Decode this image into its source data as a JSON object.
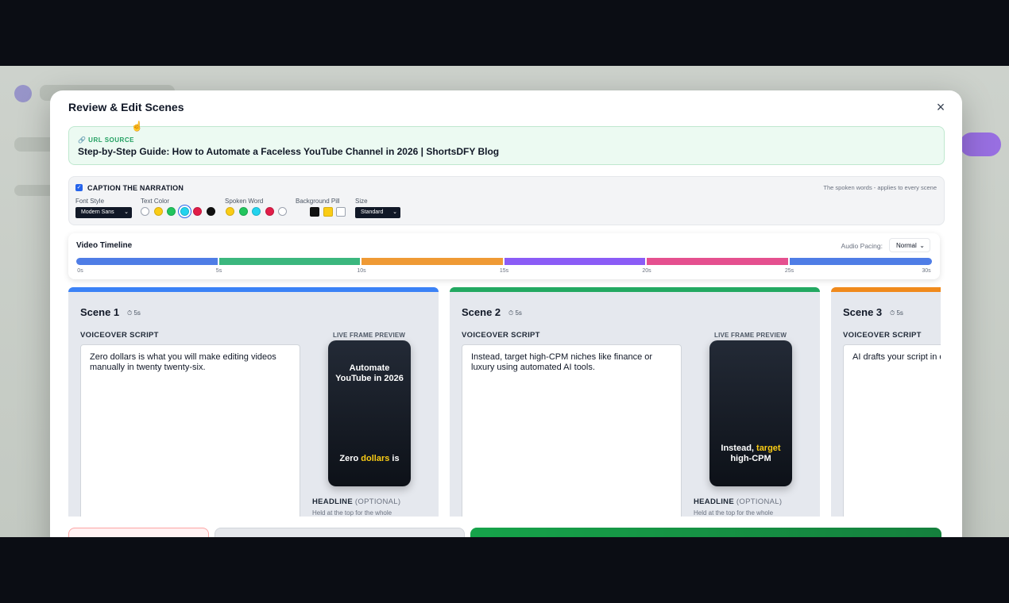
{
  "modal": {
    "title": "Review & Edit Scenes",
    "close_icon": "×"
  },
  "source": {
    "label": "🔗 URL SOURCE",
    "title": "Step-by-Step Guide: How to Automate a Faceless YouTube Channel in 2026 | ShortsDFY Blog"
  },
  "caption": {
    "checked": true,
    "title": "CAPTION THE NARRATION",
    "note": "The spoken words - applies to every scene",
    "font_style": {
      "label": "Font Style",
      "value": "Modern Sans"
    },
    "text_color": {
      "label": "Text Color",
      "swatches": [
        "#ffffff",
        "#facc15",
        "#22c55e",
        "#22d3ee",
        "#e11d48",
        "#111111"
      ],
      "selected_index": 3
    },
    "spoken_word": {
      "label": "Spoken Word",
      "swatches": [
        "#facc15",
        "#22c55e",
        "#22d3ee",
        "#e11d48",
        "#ffffff"
      ]
    },
    "background_pill": {
      "label": "Background Pill",
      "swatches": [
        "#111111",
        "#facc15",
        "#ffffff"
      ]
    },
    "size": {
      "label": "Size",
      "value": "Standard"
    }
  },
  "timeline": {
    "title": "Video Timeline",
    "pacing_label": "Audio Pacing:",
    "pacing_value": "Normal",
    "segments": [
      {
        "color": "#4f7de6",
        "duration": 5
      },
      {
        "color": "#3bb77e",
        "duration": 5
      },
      {
        "color": "#ef9a35",
        "duration": 5
      },
      {
        "color": "#8b5cf6",
        "duration": 5
      },
      {
        "color": "#e5508f",
        "duration": 5
      },
      {
        "color": "#4f7de6",
        "duration": 5
      }
    ],
    "ticks": [
      "0s",
      "5s",
      "10s",
      "15s",
      "20s",
      "25s",
      "30s"
    ]
  },
  "scenes": [
    {
      "title": "Scene 1",
      "duration": "⏱ 5s",
      "accent": "#3b82f6",
      "vo_label": "VOICEOVER SCRIPT",
      "script": "Zero dollars is what you will make editing videos manually in twenty twenty-six.",
      "preview_label": "LIVE FRAME PREVIEW",
      "preview_headline": "Automate YouTube in 2026",
      "caption_pre": "Zero ",
      "caption_hl": "dollars",
      "caption_post": " is",
      "headline_label": "HEADLINE",
      "headline_opt": "(OPTIONAL)",
      "headline_note": "Held at the top for the whole"
    },
    {
      "title": "Scene 2",
      "duration": "⏱ 5s",
      "accent": "#22a861",
      "vo_label": "VOICEOVER SCRIPT",
      "script": "Instead, target high-CPM niches like finance or luxury using automated AI tools.",
      "preview_label": "LIVE FRAME PREVIEW",
      "preview_headline": "",
      "caption_pre": "Instead, ",
      "caption_hl": "target",
      "caption_post": " high-CPM",
      "headline_label": "HEADLINE",
      "headline_opt": "(OPTIONAL)",
      "headline_note": "Held at the top for the whole"
    },
    {
      "title": "Scene 3",
      "duration": "⏱ 5s",
      "accent": "#f08a1c",
      "vo_label": "VOICEOVER SCRIPT",
      "script": "AI drafts your script in on a killer three-secon"
    }
  ]
}
